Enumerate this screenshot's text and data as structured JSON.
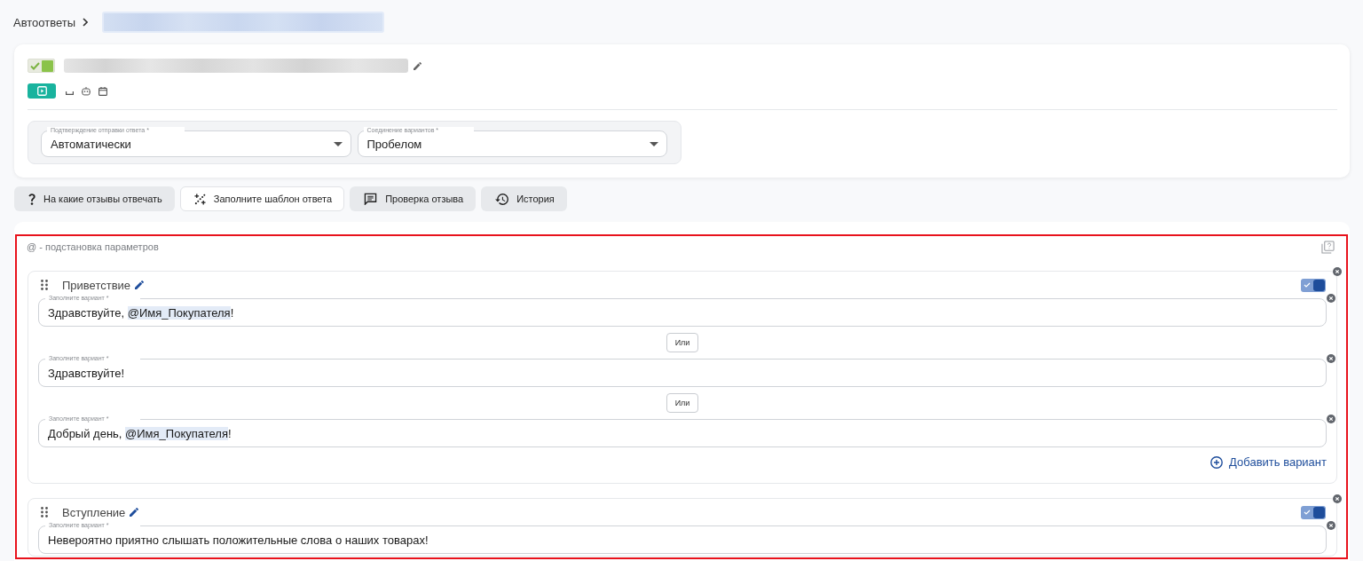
{
  "breadcrumb": {
    "root": "Автоответы"
  },
  "rule": {
    "enabled": true
  },
  "settings": [
    {
      "label": "Подтверждение отправки ответа *",
      "value": "Автоматически"
    },
    {
      "label": "Соединение вариантов *",
      "value": "Пробелом"
    }
  ],
  "tabs": [
    {
      "label": "На какие отзывы отвечать",
      "kind": "question",
      "selected": false
    },
    {
      "label": "Заполните шаблон ответа",
      "kind": "template",
      "selected": true
    },
    {
      "label": "Проверка отзыва",
      "kind": "review",
      "selected": false
    },
    {
      "label": "История",
      "kind": "history",
      "selected": false
    }
  ],
  "template": {
    "hint": "@ - подстановка параметров",
    "blocks": [
      {
        "title": "Приветствие",
        "enabled": true,
        "variants": [
          {
            "label": "Заполните вариант *",
            "segments": [
              {
                "kind": "text",
                "text": "Здравствуйте, "
              },
              {
                "kind": "param",
                "text": "@Имя_Покупателя"
              },
              {
                "kind": "text",
                "text": "!"
              }
            ]
          },
          {
            "separator": "Или",
            "label": "Заполните вариант *",
            "segments": [
              {
                "kind": "text",
                "text": "Здравствуйте!"
              }
            ]
          },
          {
            "separator": "Или",
            "label": "Заполните вариант *",
            "segments": [
              {
                "kind": "text",
                "text": "Добрый день, "
              },
              {
                "kind": "param",
                "text": "@Имя_Покупателя"
              },
              {
                "kind": "text",
                "text": "!"
              }
            ]
          }
        ],
        "add_label": "Добавить вариант"
      },
      {
        "title": "Вступление",
        "enabled": true,
        "variants": [
          {
            "label": "Заполните вариант *",
            "segments": [
              {
                "kind": "text",
                "text": "Невероятно приятно слышать положительные слова о наших товарах!"
              }
            ]
          }
        ]
      }
    ]
  }
}
